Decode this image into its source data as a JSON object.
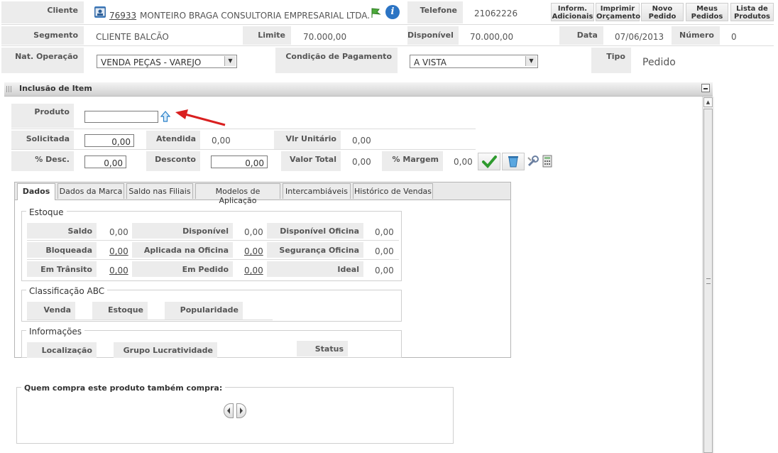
{
  "header": {
    "cliente_label": "Cliente",
    "cliente_code": "76933",
    "cliente_name": "MONTEIRO BRAGA CONSULTORIA EMPRESARIAL LTDA.",
    "telefone_label": "Telefone",
    "telefone_value": "21062226",
    "segmento_label": "Segmento",
    "segmento_value": "CLIENTE BALCÃO",
    "limite_label": "Limite",
    "limite_value": "70.000,00",
    "disponivel_label": "Disponível",
    "disponivel_value": "70.000,00",
    "data_label": "Data",
    "data_value": "07/06/2013",
    "numero_label": "Número",
    "numero_value": "0",
    "nat_label": "Nat. Operação",
    "nat_value": "VENDA PEÇAS - VAREJO",
    "cond_label": "Condição de Pagamento",
    "cond_value": "A VISTA",
    "tipo_label": "Tipo",
    "tipo_value": "Pedido"
  },
  "toolbar": {
    "inform_1": "Inform.",
    "inform_2": "Adicionais",
    "imprimir_1": "Imprimir",
    "imprimir_2": "Orçamento",
    "novo_1": "Novo",
    "novo_2": "Pedido",
    "meus_1": "Meus",
    "meus_2": "Pedidos",
    "lista_1": "Lista de",
    "lista_2": "Produtos"
  },
  "item": {
    "title": "Inclusão de Item",
    "produto_label": "Produto",
    "produto_value": "",
    "solicitada_label": "Solicitada",
    "solicitada_value": "0,00",
    "atendida_label": "Atendida",
    "atendida_value": "0,00",
    "vlr_unit_label": "Vlr Unitário",
    "vlr_unit_value": "0,00",
    "desc_pct_label": "% Desc.",
    "desc_pct_value": "0,00",
    "desconto_label": "Desconto",
    "desconto_value": "0,00",
    "valor_total_label": "Valor Total",
    "valor_total_value": "0,00",
    "margem_label": "% Margem",
    "margem_value": "0,00"
  },
  "tabs": [
    "Dados",
    "Dados da Marca",
    "Saldo nas Filiais",
    "Modelos de Aplicação",
    "Intercambiáveis",
    "Histórico de Vendas"
  ],
  "estoque": {
    "title": "Estoque",
    "saldo_label": "Saldo",
    "saldo_value": "0,00",
    "disp_label": "Disponível",
    "disp_value": "0,00",
    "disp_of_label": "Disponível Oficina",
    "disp_of_value": "0,00",
    "bloq_label": "Bloqueada",
    "bloq_value": "0,00",
    "aplic_label": "Aplicada na Oficina",
    "aplic_value": "0,00",
    "seg_label": "Segurança Oficina",
    "seg_value": "0,00",
    "transito_label": "Em Trânsito",
    "transito_value": "0,00",
    "pedido_label": "Em Pedido",
    "pedido_value": "0,00",
    "ideal_label": "Ideal",
    "ideal_value": "0,00"
  },
  "abc": {
    "title": "Classificação ABC",
    "venda_label": "Venda",
    "estoque_label": "Estoque",
    "popularidade_label": "Popularidade"
  },
  "info": {
    "title": "Informações",
    "localizacao_label": "Localização",
    "grupo_label": "Grupo Lucratividade",
    "status_label": "Status"
  },
  "related": {
    "title": "Quem compra este produto também compra:"
  },
  "colors": {
    "accent_arrow": "#d92020",
    "label_bg": "#ececec",
    "confirm_green": "#2e9a2e",
    "info_blue": "#2b74c4"
  }
}
